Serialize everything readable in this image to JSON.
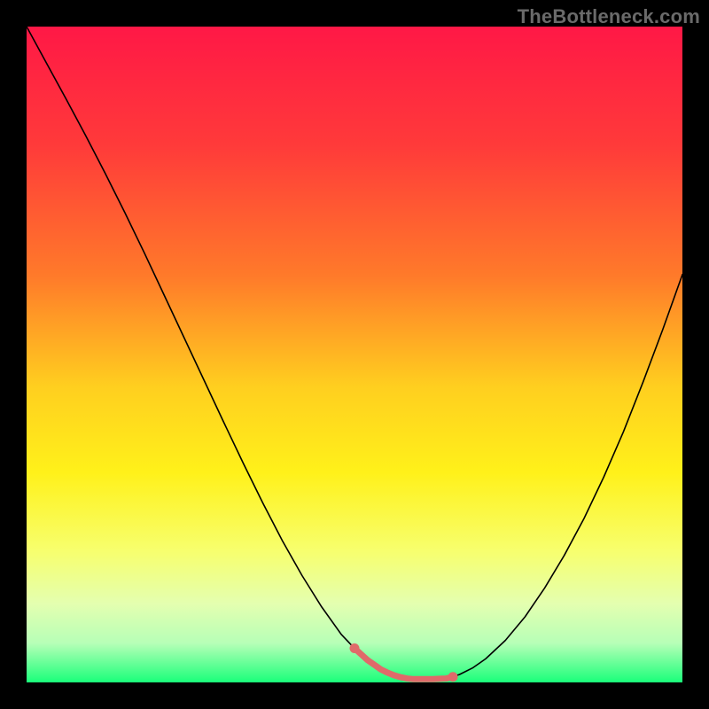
{
  "watermark": {
    "text": "TheBottleneck.com"
  },
  "chart_data": {
    "type": "line",
    "title": "",
    "xlabel": "",
    "ylabel": "",
    "xlim": [
      0,
      100
    ],
    "ylim": [
      0,
      100
    ],
    "gradient_stops": [
      {
        "offset": 0,
        "color": "#ff1846"
      },
      {
        "offset": 18,
        "color": "#ff3a3a"
      },
      {
        "offset": 38,
        "color": "#ff7a2a"
      },
      {
        "offset": 55,
        "color": "#ffcf1f"
      },
      {
        "offset": 68,
        "color": "#fff11a"
      },
      {
        "offset": 80,
        "color": "#f7ff6e"
      },
      {
        "offset": 88,
        "color": "#e4ffb0"
      },
      {
        "offset": 94,
        "color": "#b7ffb7"
      },
      {
        "offset": 100,
        "color": "#1aff7a"
      }
    ],
    "series": [
      {
        "name": "curve",
        "stroke": "#000000",
        "stroke_width": 1.6,
        "x": [
          0,
          3,
          6,
          9,
          12,
          15,
          18,
          21,
          24,
          27,
          30,
          33,
          36,
          39,
          42,
          45,
          48,
          50,
          52,
          54,
          56,
          58,
          60,
          62,
          64,
          66,
          68,
          70,
          73,
          76,
          79,
          82,
          85,
          88,
          91,
          94,
          97,
          100
        ],
        "y": [
          100,
          94.5,
          89,
          83.4,
          77.6,
          71.6,
          65.4,
          59,
          52.6,
          46.2,
          39.8,
          33.5,
          27.4,
          21.6,
          16.3,
          11.5,
          7.3,
          5.2,
          3.4,
          2.0,
          1.1,
          0.6,
          0.5,
          0.5,
          0.6,
          1.2,
          2.2,
          3.6,
          6.4,
          10.0,
          14.4,
          19.4,
          25.0,
          31.3,
          38.2,
          45.8,
          53.8,
          62.2
        ]
      },
      {
        "name": "highlight",
        "stroke": "#e06a6a",
        "stroke_width": 7,
        "x": [
          50,
          51,
          52,
          53,
          54,
          55,
          56,
          57,
          58,
          59,
          60,
          61,
          62,
          63,
          64,
          65
        ],
        "y": [
          5.2,
          4.3,
          3.4,
          2.7,
          2.0,
          1.5,
          1.1,
          0.8,
          0.6,
          0.5,
          0.5,
          0.5,
          0.5,
          0.55,
          0.6,
          0.85
        ]
      }
    ],
    "highlight_endcaps": {
      "color": "#e06a6a",
      "radius": 5.5,
      "points": [
        {
          "x": 50,
          "y": 5.2
        },
        {
          "x": 65,
          "y": 0.85
        }
      ]
    }
  }
}
